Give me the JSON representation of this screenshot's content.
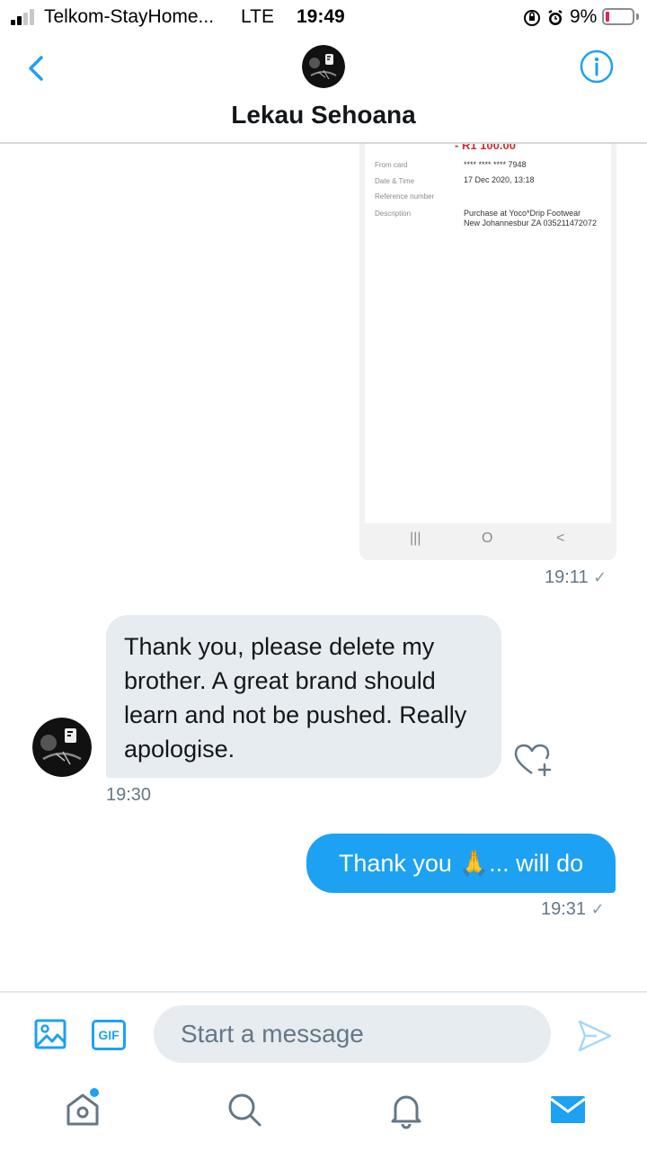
{
  "status_bar": {
    "carrier": "Telkom-StayHome...",
    "network": "LTE",
    "time": "19:49",
    "battery_percent": "9%"
  },
  "header": {
    "contact_name": "Lekau Sehoana"
  },
  "conversation": {
    "receipt": {
      "amount": "- R1 100.00",
      "fields": [
        {
          "label": "From card",
          "value": "**** **** **** 7948"
        },
        {
          "label": "Date & Time",
          "value": "17 Dec 2020, 13:18"
        },
        {
          "label": "Reference number",
          "value": ""
        },
        {
          "label": "Description",
          "value": "Purchase at Yoco*Drip Footwear New Johannesbur ZA 035211472072"
        }
      ],
      "nav_buttons": [
        "|||",
        "O",
        "<"
      ]
    },
    "receipt_time": "19:11",
    "received_text": "Thank you, please delete my brother. A great brand should learn and not be pushed. Really apologise.",
    "received_time": "19:30",
    "sent_text": "Thank you 🙏... will do",
    "sent_time": "19:31",
    "read_check": "✓"
  },
  "composer": {
    "placeholder": "Start a message",
    "gif_label": "GIF"
  },
  "tabbar": {
    "items": [
      "home-icon",
      "search-icon",
      "notifications-icon",
      "messages-icon"
    ]
  },
  "colors": {
    "accent": "#1da1f2",
    "bubble_in": "#e6ecf0",
    "muted": "#657786"
  }
}
